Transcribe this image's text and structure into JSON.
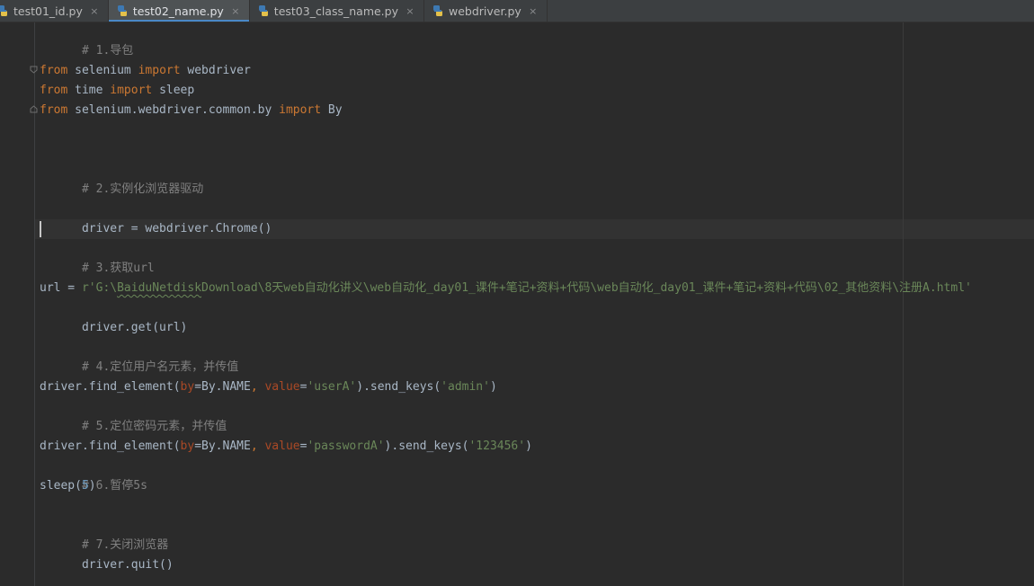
{
  "tabs": [
    {
      "label": "test01_id.py",
      "close": "×"
    },
    {
      "label": "test02_name.py",
      "close": "×",
      "active": true
    },
    {
      "label": "test03_class_name.py",
      "close": "×"
    },
    {
      "label": "webdriver.py",
      "close": "×"
    }
  ],
  "code": {
    "l1_comment": "# 1.导包",
    "l3_from": "from",
    "l3_module": " selenium ",
    "l3_import": "import",
    "l3_name": " webdriver",
    "l4_from": "from",
    "l4_module": " time ",
    "l4_import": "import",
    "l4_name": " sleep",
    "l5_from": "from",
    "l5_module": " selenium.webdriver.common.by ",
    "l5_import": "import",
    "l5_name": " By",
    "l8_comment": "# 2.实例化浏览器驱动",
    "l10_code": "driver = webdriver.Chrome()",
    "l12_comment": "# 3.获取url",
    "l14_assign": "url = ",
    "l14_prefix": "r'G:\\",
    "l14_squig": "BaiduNetdisk",
    "l14_rest": "Download\\8天web自动化讲义\\web自动化_day01_课件+笔记+资料+代码\\web自动化_day01_课件+笔记+资料+代码\\02_其他资料\\注册A.html'",
    "l15_code": "driver.get(url)",
    "l17_comment": "# 4.定位用户名元素，并传值",
    "l19_call": "driver.find_element(",
    "l19_by": "by",
    "l19_eq1": "=By.NAME",
    "l19_comma": ", ",
    "l19_value": "value",
    "l19_eq2": "=",
    "l19_arg1": "'userA'",
    "l19_mid": ").send_keys(",
    "l19_arg2": "'admin'",
    "l19_end": ")",
    "l20_comment": "# 5.定位密码元素，并传值",
    "l22_call": "driver.find_element(",
    "l22_by": "by",
    "l22_eq1": "=By.NAME",
    "l22_comma": ", ",
    "l22_value": "value",
    "l22_eq2": "=",
    "l22_arg1": "'passwordA'",
    "l22_mid": ").send_keys(",
    "l22_arg2": "'123456'",
    "l22_end": ")",
    "l23_comment": "# 6.暂停5s",
    "l24_call": "sleep(",
    "l24_num": "5",
    "l24_end": ")",
    "l26_comment": "# 7.关闭浏览器",
    "l27_code": "driver.quit()"
  },
  "colors": {
    "background": "#2b2b2b",
    "keyword": "#cc7832",
    "comment": "#808080",
    "string": "#6a8759",
    "number": "#6897bb",
    "param": "#aa4926",
    "text": "#a9b7c6",
    "tab_accent": "#4a88c7"
  },
  "icons": {
    "tab_file": "python-file-icon",
    "fold_marker": "fold-marker-icon"
  }
}
